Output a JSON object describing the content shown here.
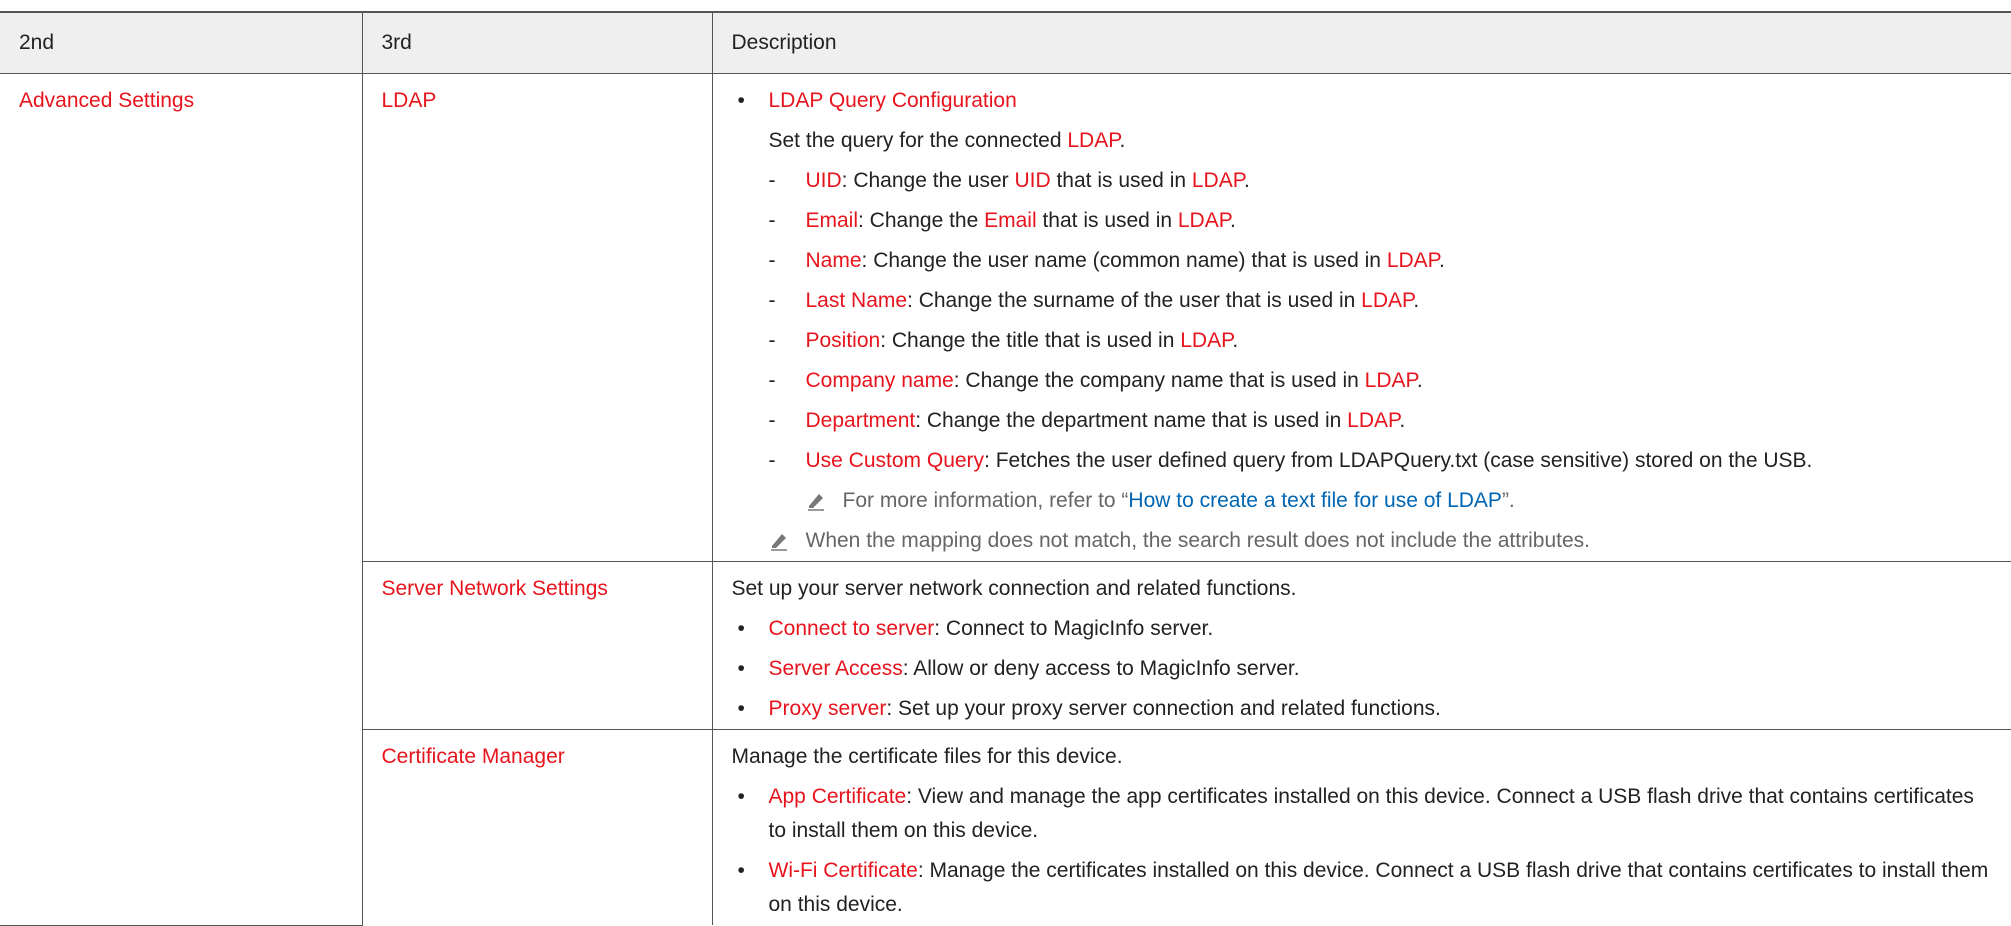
{
  "headers": {
    "col1": "2nd",
    "col2": "3rd",
    "col3": "Description"
  },
  "advanced": {
    "label": "Advanced Settings"
  },
  "ldap": {
    "label": "LDAP",
    "bullet": "LDAP Query Configuration",
    "intro": "Set the query for the connected ",
    "intro_ref": "LDAP",
    "items": [
      {
        "key": "UID",
        "pre": ": Change the user ",
        "ref1": "UID",
        "mid": " that is used in ",
        "ref2": "LDAP",
        "end": "."
      },
      {
        "key": "Email",
        "pre": ": Change the ",
        "ref1": "Email",
        "mid": " that is used in ",
        "ref2": "LDAP",
        "end": "."
      },
      {
        "key": "Name",
        "pre": ": Change the user name (common name) that is used in ",
        "ref1": "LDAP",
        "end": "."
      },
      {
        "key": "Last Name",
        "pre": ": Change the surname of the user that is used in ",
        "ref1": "LDAP",
        "end": "."
      },
      {
        "key": "Position",
        "pre": ": Change the title that is used in ",
        "ref1": "LDAP",
        "end": "."
      },
      {
        "key": "Company name",
        "pre": ": Change the company name that is used in ",
        "ref1": "LDAP",
        "end": "."
      },
      {
        "key": "Department",
        "pre": ": Change the department name that is used in ",
        "ref1": "LDAP",
        "end": "."
      },
      {
        "key": "Use Custom Query",
        "pre": ": Fetches the user defined query from LDAPQuery.txt (case sensitive) stored on the USB."
      }
    ],
    "note1_pre": "For more information, refer to “",
    "note1_link": "How to create a text file for use of LDAP",
    "note1_post": "”.",
    "note2": "When the mapping does not match, the search result does not include the attributes."
  },
  "server": {
    "label": "Server Network Settings",
    "intro": "Set up your server network connection and related functions.",
    "items": [
      {
        "key": "Connect to server",
        "text": ": Connect to MagicInfo server."
      },
      {
        "key": "Server Access",
        "text": ": Allow or deny access to MagicInfo server."
      },
      {
        "key": "Proxy server",
        "text": ": Set up your proxy server connection and related functions."
      }
    ]
  },
  "cert": {
    "label": "Certificate Manager",
    "intro": "Manage the certificate files for this device.",
    "items": [
      {
        "key": "App Certificate",
        "text": ": View and manage the app certificates installed on this device. Connect a USB flash drive that contains certificates to install them on this device."
      },
      {
        "key": "Wi-Fi Certificate",
        "text": ": Manage the certificates installed on this device. Connect a USB flash drive that contains certificates to install them on this device."
      }
    ]
  },
  "colors": {
    "accent_red": "#e8141d",
    "link_blue": "#0066b3",
    "note_gray": "#666666",
    "header_bg": "#efefef"
  },
  "icons": {
    "note": "pencil-note-icon"
  }
}
